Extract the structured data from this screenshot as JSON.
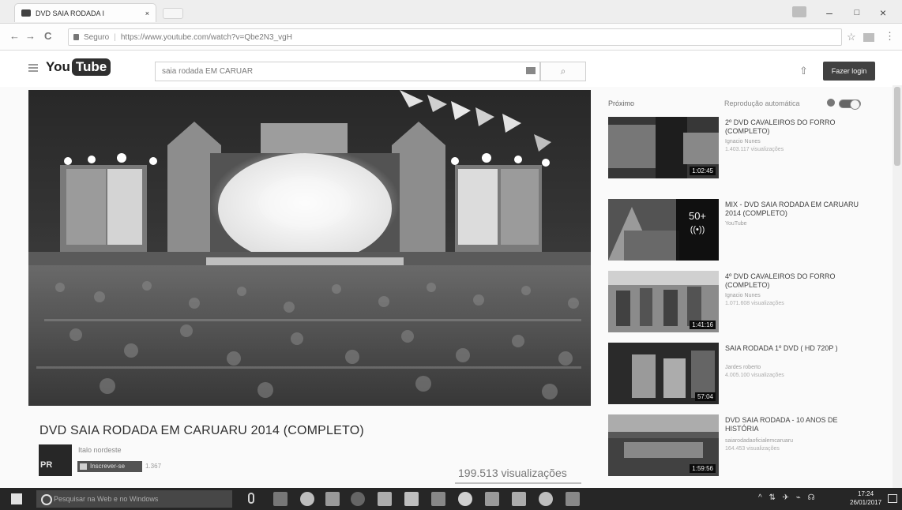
{
  "browser": {
    "tab_title": "DVD SAIA RODADA I",
    "tab_close": "×",
    "url_secure": "Seguro",
    "url": "https://www.youtube.com/watch?v=Qbe2N3_vgH",
    "back_glyph": "←",
    "forward_glyph": "→",
    "reload_glyph": "C",
    "minimize": "–",
    "maximize": "□",
    "close": "×",
    "star": "☆",
    "menu": "⋮"
  },
  "youtube": {
    "logo_you": "You",
    "logo_tube": "Tube",
    "search_value": "saia rodada EM CARUAR",
    "search_glyph": "⌕",
    "upload_glyph": "⇧",
    "signin_label": "Fazer login"
  },
  "video": {
    "title": "DVD SAIA RODADA EM CARUARU 2014 (COMPLETO)",
    "channel_avatar": "PR",
    "channel_name": "Italo nordeste",
    "subscribe_label": "Inscrever-se",
    "subscriber_count": "1.367",
    "views": "199.513 visualizações"
  },
  "sidebar": {
    "next_label": "Próximo",
    "autoplay_label": "Reprodução automática",
    "items": [
      {
        "title": "2º DVD CAVALEIROS DO FORRO (COMPLETO)",
        "channel": "Ignacio Nunes",
        "views": "1.403.117 visualizações",
        "duration": "1:02:45"
      },
      {
        "title": "Mix - DVD SAIA RODADA EM CARUARU 2014 (COMPLETO)",
        "channel": "YouTube",
        "views": "",
        "duration": "",
        "mix_count": "50+",
        "mix_icon": "((•))"
      },
      {
        "title": "4º DVD CAVALEIROS DO FORRO (COMPLETO)",
        "channel": "Ignacio Nunes",
        "views": "1.071.608 visualizações",
        "duration": "1:41:16"
      },
      {
        "title": "SAIA RODADA 1º DVD ( HD 720p )",
        "channel": "Jardes roberto",
        "views": "4.005.100 visualizações",
        "duration": "57:04"
      },
      {
        "title": "DVD SAIA RODADA - 10 ANOS DE HISTÓRIA",
        "channel": "saiarodadaoficialemcaruaru",
        "views": "164.453 visualizações",
        "duration": "1:59:56"
      }
    ]
  },
  "taskbar": {
    "search_placeholder": "Pesquisar na Web e no Windows",
    "tray": "^ ⇅ ✈ ⌁ ☊",
    "time": "17:24",
    "date": "26/01/2017"
  }
}
